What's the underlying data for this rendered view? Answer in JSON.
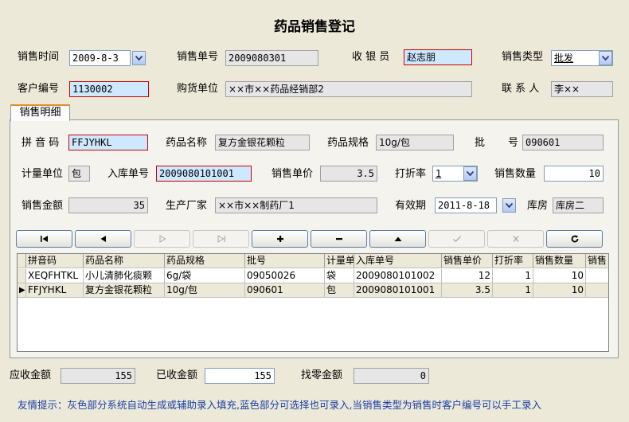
{
  "title": "药品销售登记",
  "header": {
    "sale_time_label": "销售时间",
    "sale_time_value": "2009-8-3",
    "sale_no_label": "销售单号",
    "sale_no_value": "2009080301",
    "cashier_label": "收 银 员",
    "cashier_value": "赵志朋",
    "sale_type_label": "销售类型",
    "sale_type_value": "批发",
    "customer_no_label": "客户编号",
    "customer_no_value": "1130002",
    "buyer_label": "购货单位",
    "buyer_value": "××市××药品经销部2",
    "contact_label": "联 系 人",
    "contact_value": "李××"
  },
  "tab": {
    "label": "销售明细"
  },
  "detail": {
    "pinyin_label": "拼 音 码",
    "pinyin_value": "FFJYHKL",
    "drug_name_label": "药品名称",
    "drug_name_value": "复方金银花颗粒",
    "spec_label": "药品规格",
    "spec_value": "10g/包",
    "batch_label_1": "批",
    "batch_label_2": "号",
    "batch_value": "090601",
    "unit_label": "计量单位",
    "unit_value": "包",
    "stock_no_label": "入库单号",
    "stock_no_value": "2009080101001",
    "price_label": "销售单价",
    "price_value": "3.5",
    "discount_label": "打折率",
    "discount_value": "1",
    "qty_label": "销售数量",
    "qty_value": "10",
    "amount_label": "销售金额",
    "amount_value": "35",
    "maker_label": "生产厂家",
    "maker_value": "××市××制药厂1",
    "expiry_label": "有效期",
    "expiry_value": "2011-8-18",
    "warehouse_label": "库房",
    "warehouse_value": "库房二"
  },
  "grid": {
    "columns": [
      "拼音码",
      "药品名称",
      "药品规格",
      "批号",
      "计量单",
      "入库单号",
      "销售单价",
      "打折率",
      "销售数量",
      "销售"
    ],
    "rows": [
      {
        "indicator": "",
        "cells": [
          "XEQFHTKL",
          "小儿清肺化痰颗",
          "6g/袋",
          "09050026",
          "袋",
          "2009080101002",
          "12",
          "1",
          "10",
          ""
        ]
      },
      {
        "indicator": "▶",
        "cells": [
          "FFJYHKL",
          "复方金银花颗粒",
          "10g/包",
          "090601",
          "包",
          "2009080101001",
          "3.5",
          "1",
          "10",
          ""
        ]
      }
    ]
  },
  "footer": {
    "receivable_label": "应收金额",
    "receivable_value": "155",
    "received_label": "已收金额",
    "received_value": "155",
    "change_label": "找零金额",
    "change_value": "0",
    "tip": "友情提示：灰色部分系统自动生成或辅助录入填充,蓝色部分可选择也可录入,当销售类型为销售时客户编号可以手工录入"
  }
}
